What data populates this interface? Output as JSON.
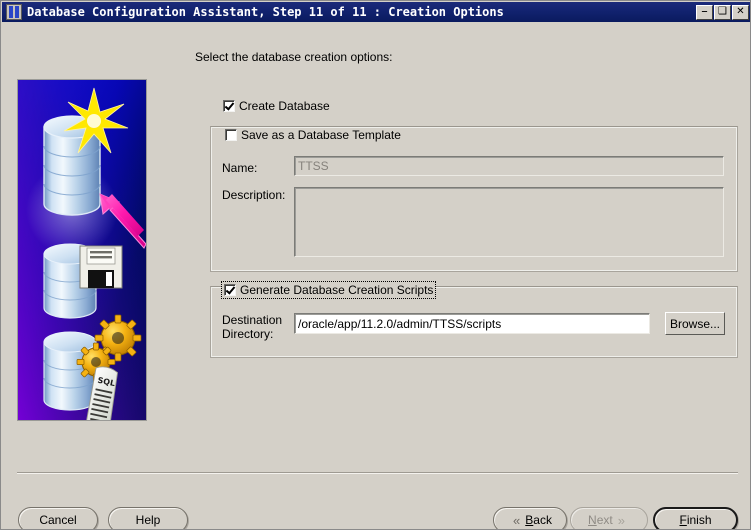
{
  "window": {
    "title": "Database Configuration Assistant, Step 11 of 11 : Creation Options",
    "icon": "database-icon",
    "controls": {
      "minimize": "–",
      "maximize": "❑",
      "close": "✕"
    }
  },
  "main": {
    "instruction": "Select the database creation options:",
    "create_database": {
      "label": "Create Database",
      "checked": true
    },
    "template_group": {
      "title": "Save as a Database Template",
      "checked": false,
      "name_label": "Name:",
      "name_value": "TTSS",
      "description_label": "Description:",
      "description_value": ""
    },
    "scripts_group": {
      "title": "Generate Database Creation Scripts",
      "checked": true,
      "destination_label_line1": "Destination",
      "destination_label_line2": "Directory:",
      "destination_value": "/oracle/app/11.2.0/admin/TTSS/scripts",
      "browse_label": "Browse..."
    }
  },
  "footer": {
    "cancel": "Cancel",
    "help": "Help",
    "back": "Back",
    "back_mnemonic": "B",
    "back_rest": "ack",
    "back_chevron": "«",
    "next": "Next",
    "next_mnemonic": "N",
    "next_rest": "ext",
    "next_chevron": "»",
    "next_disabled": true,
    "finish": "Finish",
    "finish_mnemonic": "F",
    "finish_rest": "inish"
  },
  "graphic": {
    "name": "oracle-database-creation-illustration",
    "colors": {
      "bg_blue": "#0a0ad8",
      "bg_dark": "#000a5a",
      "bg_purple": "#6a00c8",
      "cylinder_light": "#e8f2fb",
      "cylinder_mid": "#a8c6e4",
      "cylinder_dark": "#5f87b8",
      "star_yellow": "#ffe400",
      "arrow_magenta": "#ff22b4",
      "gear_orange": "#f0a800",
      "scroll_white": "#f4f4ee"
    },
    "scroll_label": "SQL"
  }
}
